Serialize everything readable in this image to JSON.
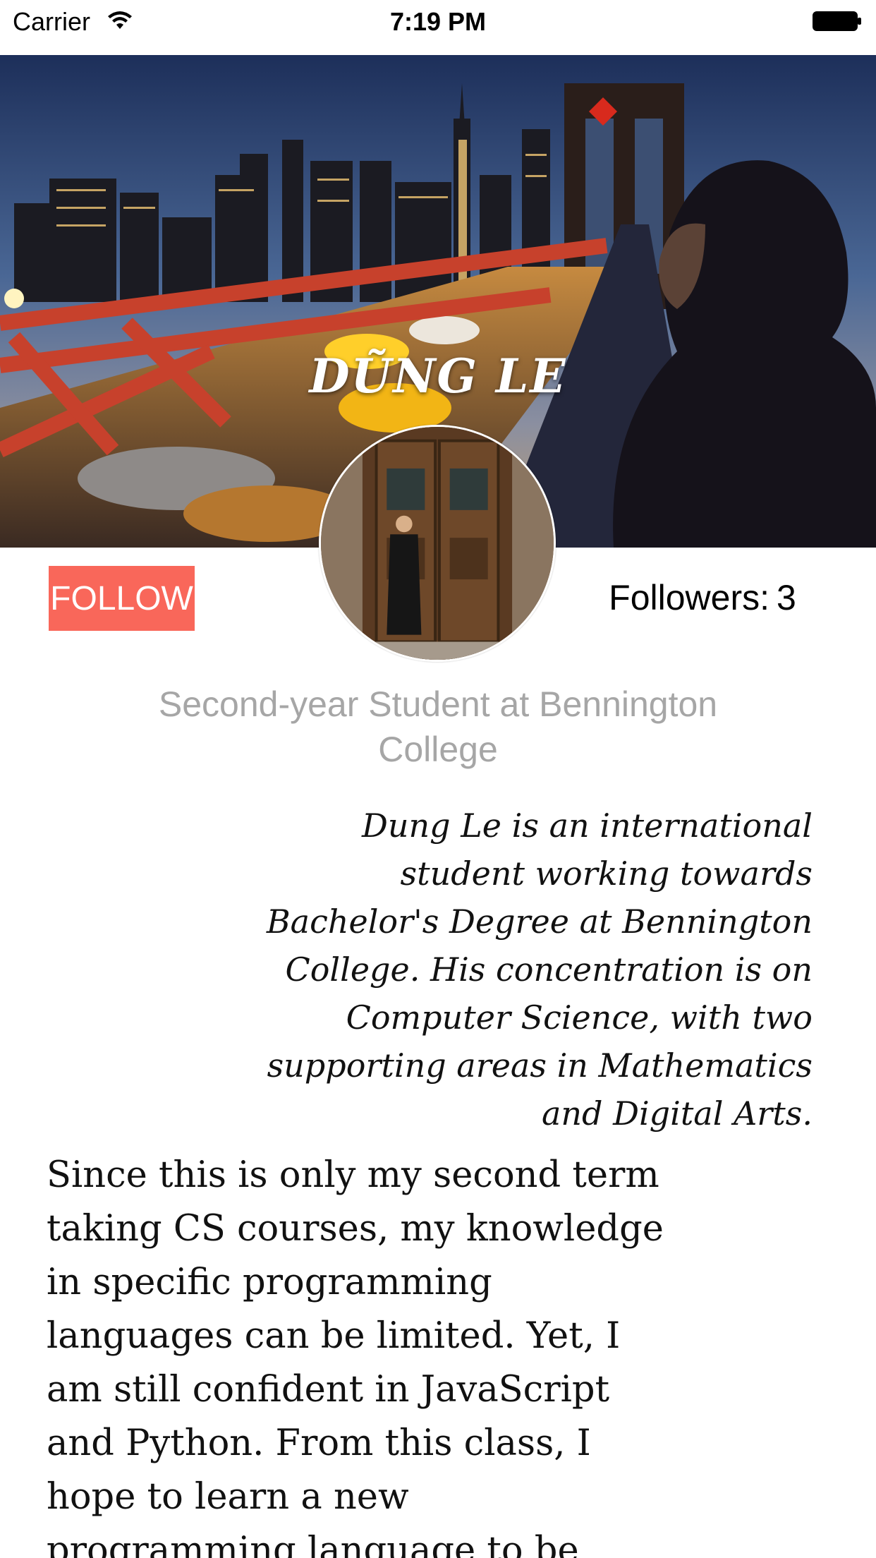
{
  "status_bar": {
    "carrier": "Carrier",
    "time": "7:19 PM"
  },
  "profile": {
    "name": "DŨNG LE",
    "follow_label": "FOLLOW",
    "followers_label": "Followers:",
    "followers_count": "3",
    "subtitle": "Second-year Student at Bennington College",
    "bio": "Dung Le is an international student working towards Bachelor's Degree at Bennington College. His concentration is on Computer Science, with two supporting areas in Mathematics and Digital Arts.",
    "about": "Since this is only my second term taking CS courses, my knowledge in specific programming languages can be limited. Yet, I am still confident in JavaScript and Python. From this class, I hope to learn a new programming language to be"
  },
  "colors": {
    "follow_button": "#f9675a",
    "subtitle": "#a6a6a6"
  },
  "icons": {
    "wifi": "wifi-icon",
    "battery": "battery-icon"
  }
}
